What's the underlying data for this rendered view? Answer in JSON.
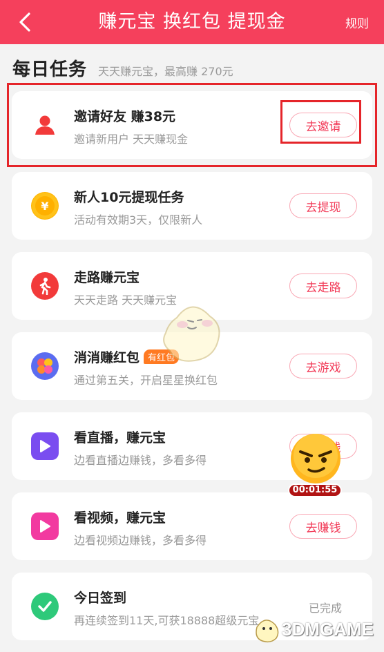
{
  "header": {
    "title": "赚元宝 换红包 提现金",
    "rules_label": "规则"
  },
  "section": {
    "title": "每日任务",
    "subtitle": "天天赚元宝，最高赚 270元"
  },
  "tasks": [
    {
      "title": "邀请好友 赚38元",
      "subtitle": "邀请新用户 天天赚现金",
      "button": "去邀请",
      "icon": "user-icon",
      "icon_color": "#f23a3a"
    },
    {
      "title": "新人10元提现任务",
      "subtitle": "活动有效期3天，仅限新人",
      "button": "去提现",
      "icon": "yen-coin-icon",
      "icon_color": "#ffb400"
    },
    {
      "title": "走路赚元宝",
      "subtitle": "天天走路 天天赚元宝",
      "button": "去走路",
      "icon": "walking-icon",
      "icon_color": "#f23a3a"
    },
    {
      "title": "消消赚红包",
      "badge": "有红包",
      "subtitle": "通过第五关，开启星星换红包",
      "button": "去游戏",
      "icon": "game-tiles-icon",
      "icon_color": "#5b6cf0"
    },
    {
      "title": "看直播，赚元宝",
      "subtitle": "边看直播边赚钱，多看多得",
      "button": "去赚钱",
      "icon": "play-icon",
      "icon_color": "#7a4df0"
    },
    {
      "title": "看视频，赚元宝",
      "subtitle": "边看视频边赚钱，多看多得",
      "button": "去赚钱",
      "icon": "play-icon",
      "icon_color": "#f23aa0"
    },
    {
      "title": "今日签到",
      "subtitle": "再连续签到11天,可获18888超级元宝",
      "status": "已完成",
      "icon": "check-icon",
      "icon_color": "#2ec97a"
    }
  ],
  "timer": {
    "value": "00:01:55"
  },
  "watermark": {
    "text": "3DMGAME"
  },
  "colors": {
    "brand": "#f5405c",
    "highlight": "#e5252a",
    "button_text": "#f23a57"
  }
}
